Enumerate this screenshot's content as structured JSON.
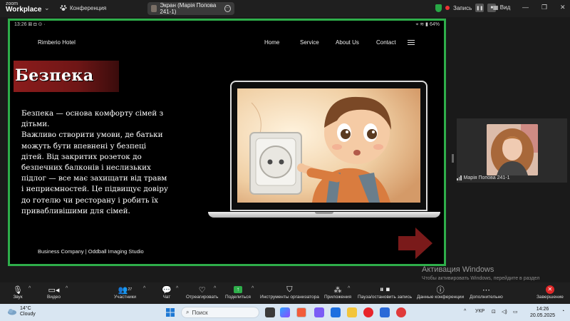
{
  "zoom_top": {
    "logo_line1": "zoom",
    "logo_line2": "Workplace",
    "conference_label": "Конференция",
    "share_label": "Экран (Марія Попова 241-1)",
    "recording_label": "Запись",
    "view_label": "Вид"
  },
  "tablet": {
    "time": "13:26",
    "battery": "64%"
  },
  "site": {
    "brand": "Rimberio Hotel",
    "nav": [
      "Home",
      "Service",
      "About Us",
      "Contact"
    ],
    "title": "Безпека",
    "body": "Безпека — основа комфорту сімей з дітьми.\n Важливо створити умови, де батьки можуть бути впевнені у безпеці дітей. Від закритих розеток до безпечних балконів і неслизьких підлог — все має захищати від травм і неприємностей. Це підвищує довіру до готелю чи ресторану і робить їх привабливішими для сімей.",
    "footer": "Business Company | Oddball Imaging Studio",
    "accent_color": "#7a1a1a"
  },
  "participant": {
    "name": "Марія Попова 241-1"
  },
  "windows_watermark": {
    "title": "Активация Windows",
    "subtitle": "Чтобы активировать Windows, перейдите в раздел \"Параметры\"."
  },
  "toolbar": {
    "audio": "Звук",
    "video": "Видео",
    "participants": "Участники",
    "participants_count": "27",
    "chat": "Чат",
    "react": "Отреагировать",
    "share": "Поделиться",
    "host_tools": "Инструменты организатора",
    "apps": "Приложения",
    "pause_rec": "Пауза/остановить запись",
    "meeting_info": "Данные конференции",
    "more": "Дополнительно",
    "end": "Завершение"
  },
  "taskbar": {
    "temp": "14°C",
    "weather": "Cloudy",
    "search": "Поиск",
    "lang": "УКР",
    "time": "14:26",
    "date": "20.05.2025"
  }
}
